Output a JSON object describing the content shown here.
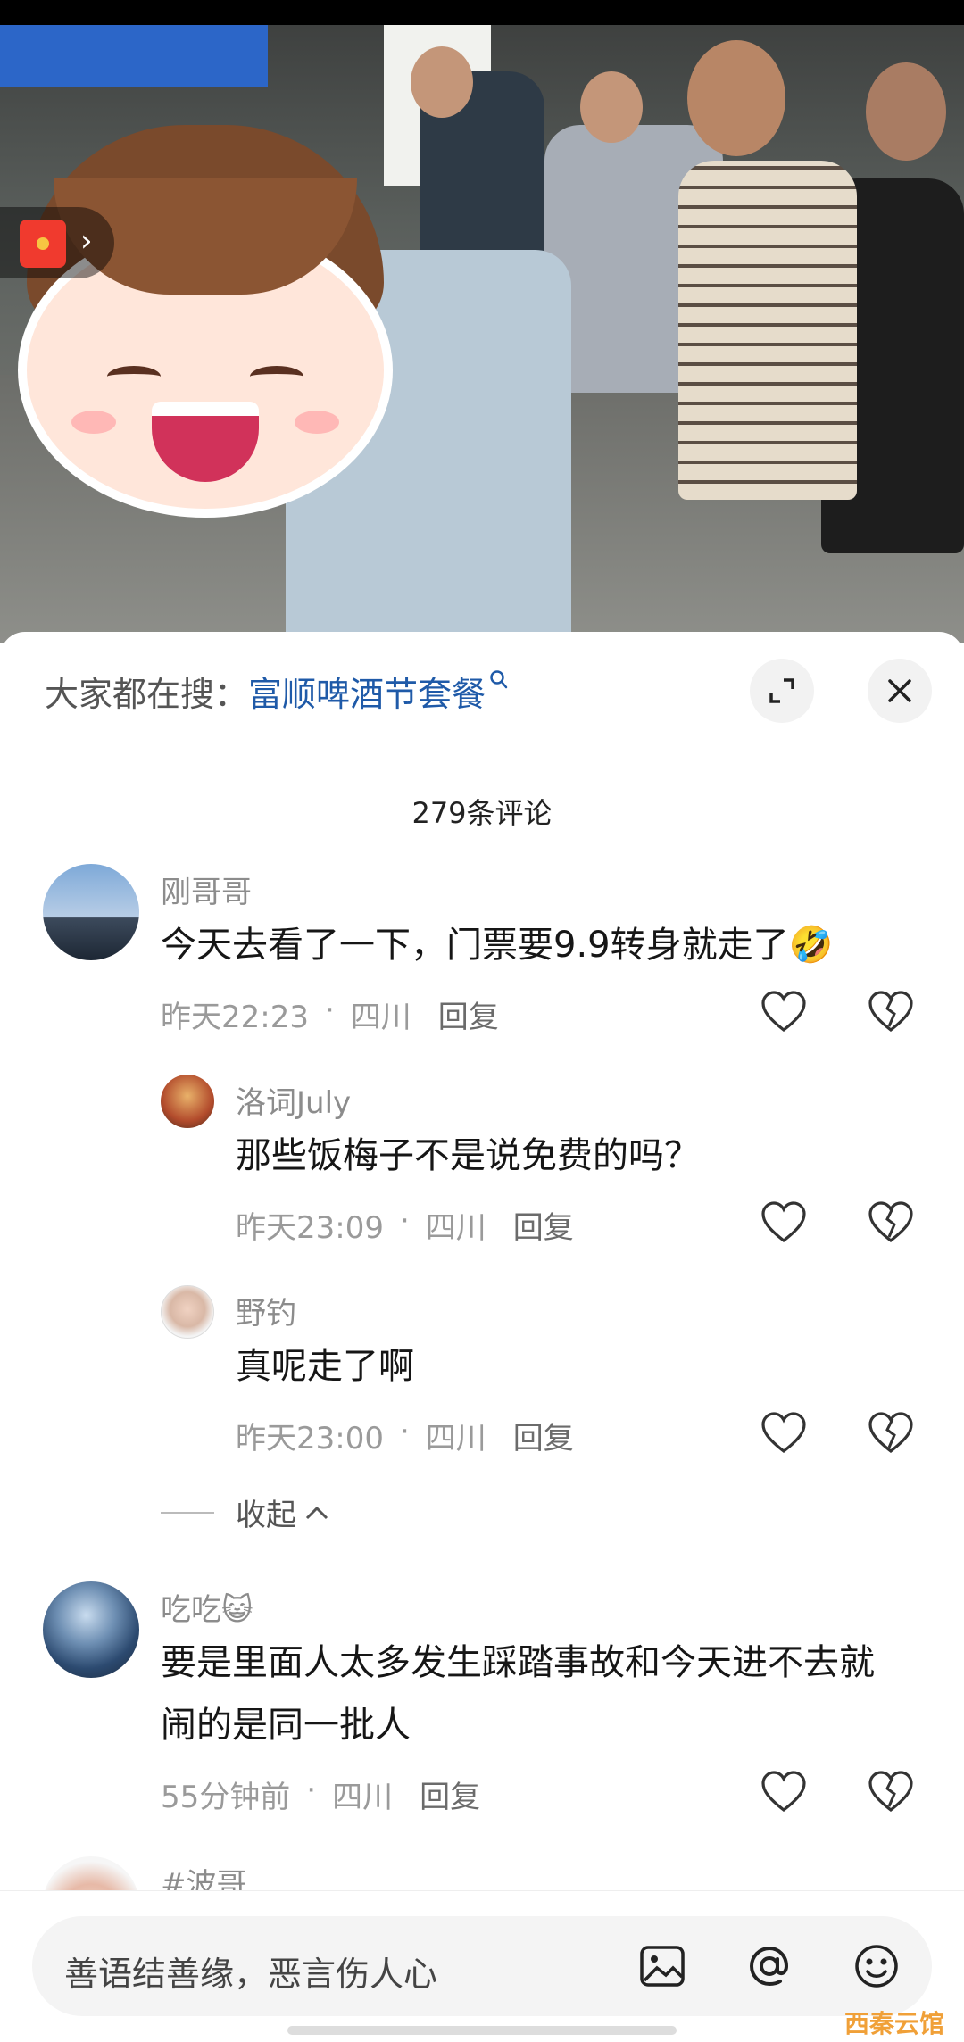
{
  "search": {
    "prefix": "大家都在搜：",
    "term": "富顺啤酒节套餐"
  },
  "comments_count": "279条评论",
  "comments": [
    {
      "user": "刚哥哥",
      "text": "今天去看了一下，门票要9.9转身就走了🤣",
      "time": "昨天22:23",
      "location": "四川",
      "reply_label": "回复"
    },
    {
      "user": "吃吃😺",
      "text": "要是里面人太多发生踩踏事故和今天进不去就闹的是同一批人",
      "time": "55分钟前",
      "location": "四川",
      "reply_label": "回复"
    }
  ],
  "replies": [
    {
      "user": "洛词July",
      "text": "那些饭梅子不是说免费的吗？",
      "time": "昨天23:09",
      "location": "四川",
      "reply_label": "回复"
    },
    {
      "user": "野钓",
      "text": "真呢走了啊",
      "time": "昨天23:00",
      "location": "四川",
      "reply_label": "回复"
    }
  ],
  "collapse_label": "收起",
  "next_user": "#波哥",
  "input": {
    "placeholder": "善语结善缘，恶言伤人心"
  },
  "icons": {
    "expand": "expand-icon",
    "close": "close-icon",
    "like": "heart-icon",
    "unlike": "broken-heart-icon",
    "image": "image-icon",
    "mention": "at-icon",
    "emoji": "emoji-icon",
    "red_packet": "red-packet-icon"
  },
  "watermark": "西秦云馆"
}
